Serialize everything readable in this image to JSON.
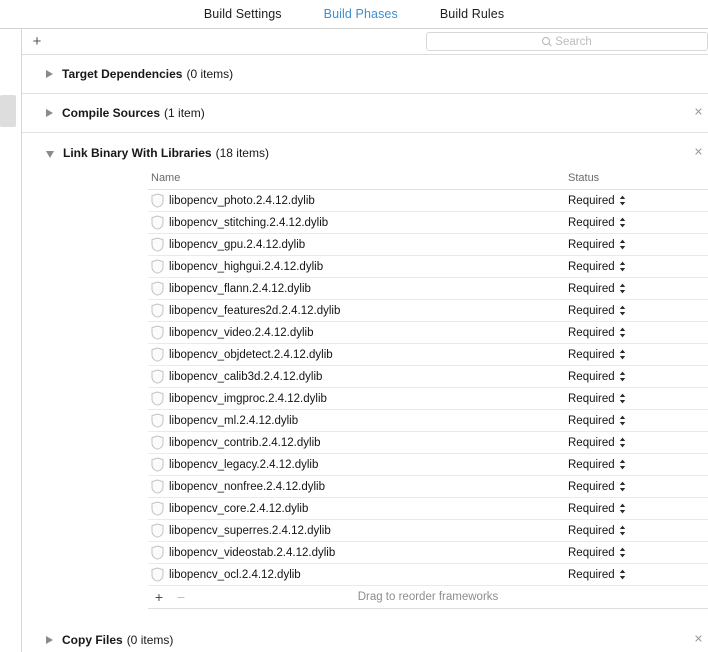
{
  "tabs": [
    {
      "label": "Build Settings",
      "active": false
    },
    {
      "label": "Build Phases",
      "active": true
    },
    {
      "label": "Build Rules",
      "active": false
    }
  ],
  "toolbar": {
    "add_label": "+",
    "search_placeholder": "Search",
    "search_value": "",
    "search_icon": "search-icon"
  },
  "colors": {
    "active_tab": "#3d8fd1",
    "text": "#1a1a1a",
    "muted": "#8d8d8d",
    "separator": "#e2e2e2"
  },
  "phases": [
    {
      "title": "Target Dependencies",
      "count": "(0 items)",
      "expanded": false,
      "closable": false
    },
    {
      "title": "Compile Sources",
      "count": "(1 item)",
      "expanded": false,
      "closable": true
    },
    {
      "title": "Link Binary With Libraries",
      "count": "(18 items)",
      "expanded": true,
      "closable": true
    },
    {
      "title": "Copy Files",
      "count": "(0 items)",
      "expanded": false,
      "closable": true
    }
  ],
  "table": {
    "columns": {
      "name": "Name",
      "status": "Status"
    },
    "rows": [
      {
        "name": "libopencv_photo.2.4.12.dylib",
        "status": "Required"
      },
      {
        "name": "libopencv_stitching.2.4.12.dylib",
        "status": "Required"
      },
      {
        "name": "libopencv_gpu.2.4.12.dylib",
        "status": "Required"
      },
      {
        "name": "libopencv_highgui.2.4.12.dylib",
        "status": "Required"
      },
      {
        "name": "libopencv_flann.2.4.12.dylib",
        "status": "Required"
      },
      {
        "name": "libopencv_features2d.2.4.12.dylib",
        "status": "Required"
      },
      {
        "name": "libopencv_video.2.4.12.dylib",
        "status": "Required"
      },
      {
        "name": "libopencv_objdetect.2.4.12.dylib",
        "status": "Required"
      },
      {
        "name": "libopencv_calib3d.2.4.12.dylib",
        "status": "Required"
      },
      {
        "name": "libopencv_imgproc.2.4.12.dylib",
        "status": "Required"
      },
      {
        "name": "libopencv_ml.2.4.12.dylib",
        "status": "Required"
      },
      {
        "name": "libopencv_contrib.2.4.12.dylib",
        "status": "Required"
      },
      {
        "name": "libopencv_legacy.2.4.12.dylib",
        "status": "Required"
      },
      {
        "name": "libopencv_nonfree.2.4.12.dylib",
        "status": "Required"
      },
      {
        "name": "libopencv_core.2.4.12.dylib",
        "status": "Required"
      },
      {
        "name": "libopencv_superres.2.4.12.dylib",
        "status": "Required"
      },
      {
        "name": "libopencv_videostab.2.4.12.dylib",
        "status": "Required"
      },
      {
        "name": "libopencv_ocl.2.4.12.dylib",
        "status": "Required"
      }
    ]
  },
  "list_footer": {
    "add_label": "+",
    "remove_label": "−",
    "hint": "Drag to reorder frameworks"
  },
  "close_glyph": "✕"
}
